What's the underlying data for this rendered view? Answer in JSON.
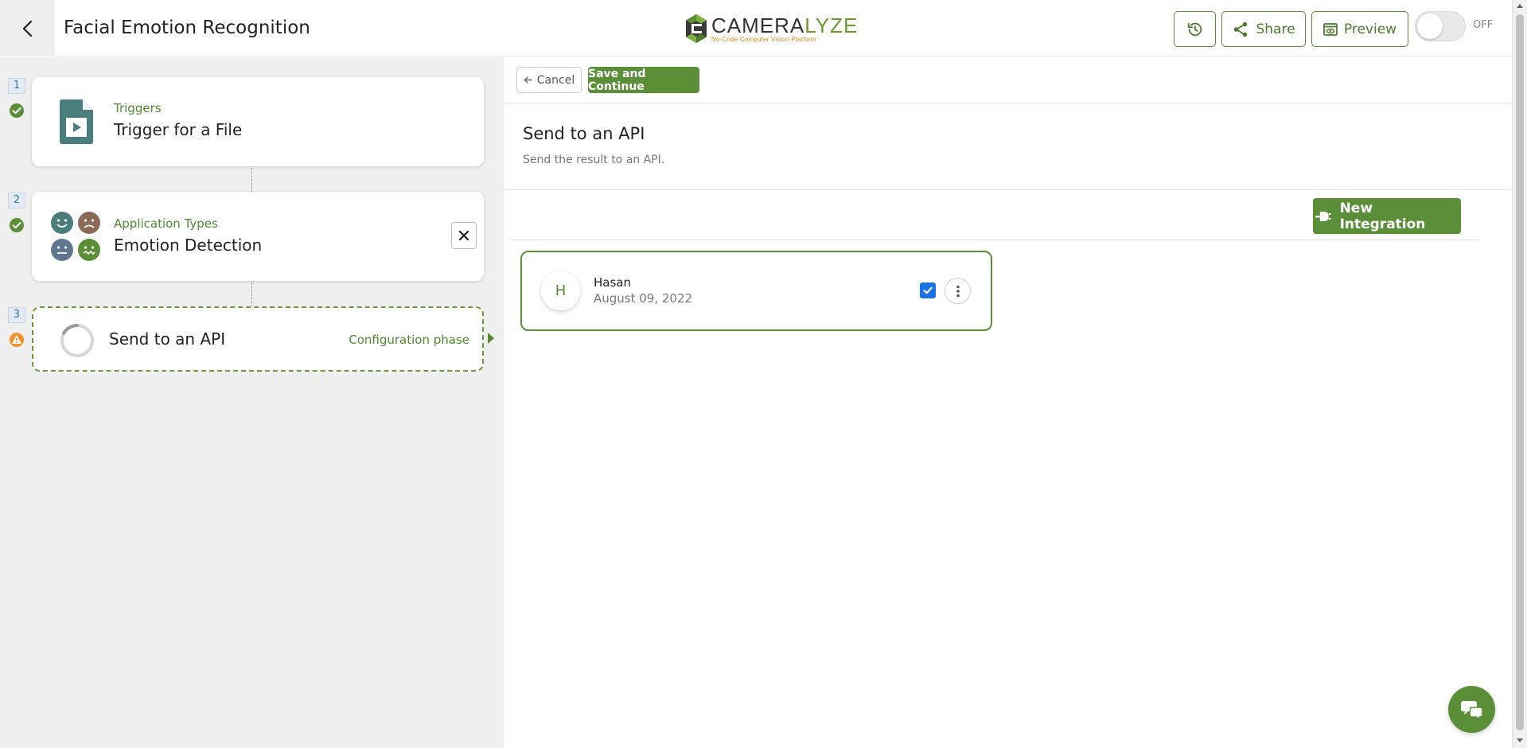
{
  "header": {
    "back_icon": "chevron-left-icon",
    "title": "Facial Emotion Recognition",
    "logo": {
      "word_main": "CAMERA",
      "word_accent": "LYZE",
      "tagline": "No-Code Computer Vision Platform"
    },
    "share_label": "Share",
    "preview_label": "Preview",
    "toggle_label": "OFF",
    "toggle_on": false
  },
  "steps": [
    {
      "number": "1",
      "status": "complete",
      "subtitle": "Triggers",
      "title": "Trigger for a File",
      "icon": "file-video-icon"
    },
    {
      "number": "2",
      "status": "complete",
      "subtitle": "Application Types",
      "title": "Emotion Detection",
      "icon": "emotion-faces-icon"
    },
    {
      "number": "3",
      "status": "warning",
      "subtitle": "",
      "title": "Send to an API",
      "phase": "Configuration phase",
      "icon": "loading-spinner-icon"
    }
  ],
  "toolbar": {
    "cancel_label": "Cancel",
    "save_label": "Save and Continue"
  },
  "section": {
    "title": "Send to an API",
    "description": "Send the result to an API."
  },
  "new_integration_label": "New Integration",
  "integrations": [
    {
      "initial": "H",
      "name": "Hasan",
      "date": "August 09, 2022",
      "selected": true
    }
  ],
  "colors": {
    "brand_green": "#5a8f38",
    "accent_orange": "#e08a1e",
    "checkbox_blue": "#1a73e8",
    "warning_orange": "#f0932b"
  }
}
